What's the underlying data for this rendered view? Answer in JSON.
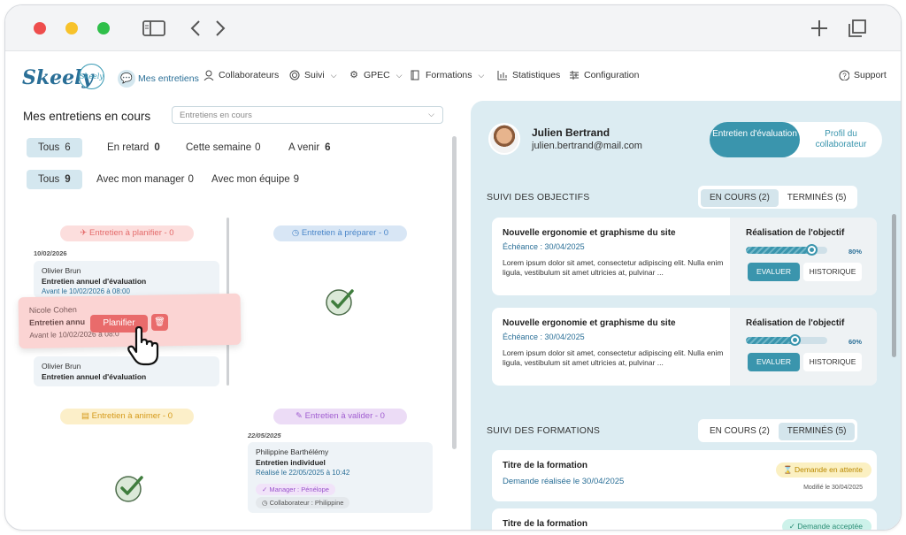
{
  "nav": {
    "logo": "Skeely",
    "logo_badge": "Skeely",
    "items": [
      {
        "label": "Mes entretiens",
        "icon": "chat-icon"
      },
      {
        "label": "Collaborateurs",
        "icon": "user-icon"
      },
      {
        "label": "Suivi",
        "icon": "target-icon"
      },
      {
        "label": "GPEC",
        "icon": "gear-icon"
      },
      {
        "label": "Formations",
        "icon": "book-icon"
      },
      {
        "label": "Statistiques",
        "icon": "chart-icon"
      },
      {
        "label": "Configuration",
        "icon": "sliders-icon"
      }
    ],
    "support": "Support"
  },
  "left": {
    "title": "Mes entretiens en cours",
    "select_value": "Entretiens en cours",
    "filters1": [
      {
        "label": "Tous",
        "count": "6"
      },
      {
        "label": "En retard",
        "count": "0"
      },
      {
        "label": "Cette semaine",
        "count": "0"
      },
      {
        "label": "A venir",
        "count": "6"
      }
    ],
    "filters2": [
      {
        "label": "Tous",
        "count": "9"
      },
      {
        "label": "Avec mon manager",
        "count": "0"
      },
      {
        "label": "Avec mon équipe",
        "count": "9"
      }
    ],
    "columns": {
      "planifier": "Entretien à planifier - 0",
      "preparer": "Entretien à préparer - 0",
      "animer": "Entretien à animer - 0",
      "valider": "Entretien à valider - 0"
    },
    "date1": "10/02/2026",
    "card1": {
      "name": "Olivier Brun",
      "title": "Entretien annuel d'évaluation",
      "date": "Avant le 10/02/2026 à 08:00"
    },
    "drag_card": {
      "name": "Nicole Cohen",
      "title": "Entretien annu",
      "date": "Avant le 10/02/2026 à 08:0"
    },
    "plan_button": "Planifier",
    "card3": {
      "name": "Olivier Brun",
      "title": "Entretien annuel d'évaluation"
    },
    "date2": "22/05/2025",
    "card4": {
      "name": "Philippine Barthélémy",
      "title": "Entretien individuel",
      "date": "Réalisé le 22/05/2025 à 10:42",
      "tag1": "Manager : Pénélope",
      "tag2": "Collaborateur : Philippine"
    }
  },
  "right": {
    "user_name": "Julien Bertrand",
    "user_email": "julien.bertrand@mail.com",
    "toggle_a": "Entretien d'évaluation",
    "toggle_b": "Profil du collaborateur",
    "objectives_title": "SUIVI DES OBJECTIFS",
    "obj_tab_a": "EN COURS (2)",
    "obj_tab_b": "TERMINÉS (5)",
    "objectives": [
      {
        "title": "Nouvelle ergonomie et graphisme du site",
        "date": "Échéance : 30/04/2025",
        "text": "Lorem ipsum dolor sit amet, consectetur adipiscing elit. Nulla enim ligula, vestibulum sit amet ultricies at, pulvinar ...",
        "label": "Réalisation de l'objectif",
        "progress": 80,
        "pct": "80%",
        "btn_eval": "EVALUER",
        "btn_hist": "HISTORIQUE"
      },
      {
        "title": "Nouvelle ergonomie et graphisme du site",
        "date": "Échéance : 30/04/2025",
        "text": "Lorem ipsum dolor sit amet, consectetur adipiscing elit. Nulla enim ligula, vestibulum sit amet ultricies at, pulvinar ...",
        "label": "Réalisation de l'objectif",
        "progress": 60,
        "pct": "60%",
        "btn_eval": "EVALUER",
        "btn_hist": "HISTORIQUE"
      }
    ],
    "formations_title": "SUIVI DES FORMATIONS",
    "form_tab_a": "EN COURS (2)",
    "form_tab_b": "TERMINÉS (5)",
    "formations": [
      {
        "title": "Titre de la formation",
        "date": "Demande réalisée le 30/04/2025",
        "badge": "Demande en attente",
        "modified": "Modifié le 30/04/2025"
      },
      {
        "title": "Titre de la formation",
        "badge": "Demande acceptée"
      }
    ]
  },
  "colors": {
    "accent": "#3a95ad",
    "brand": "#2a6f97",
    "panel": "#dcecf2",
    "danger": "#e96b6b"
  }
}
